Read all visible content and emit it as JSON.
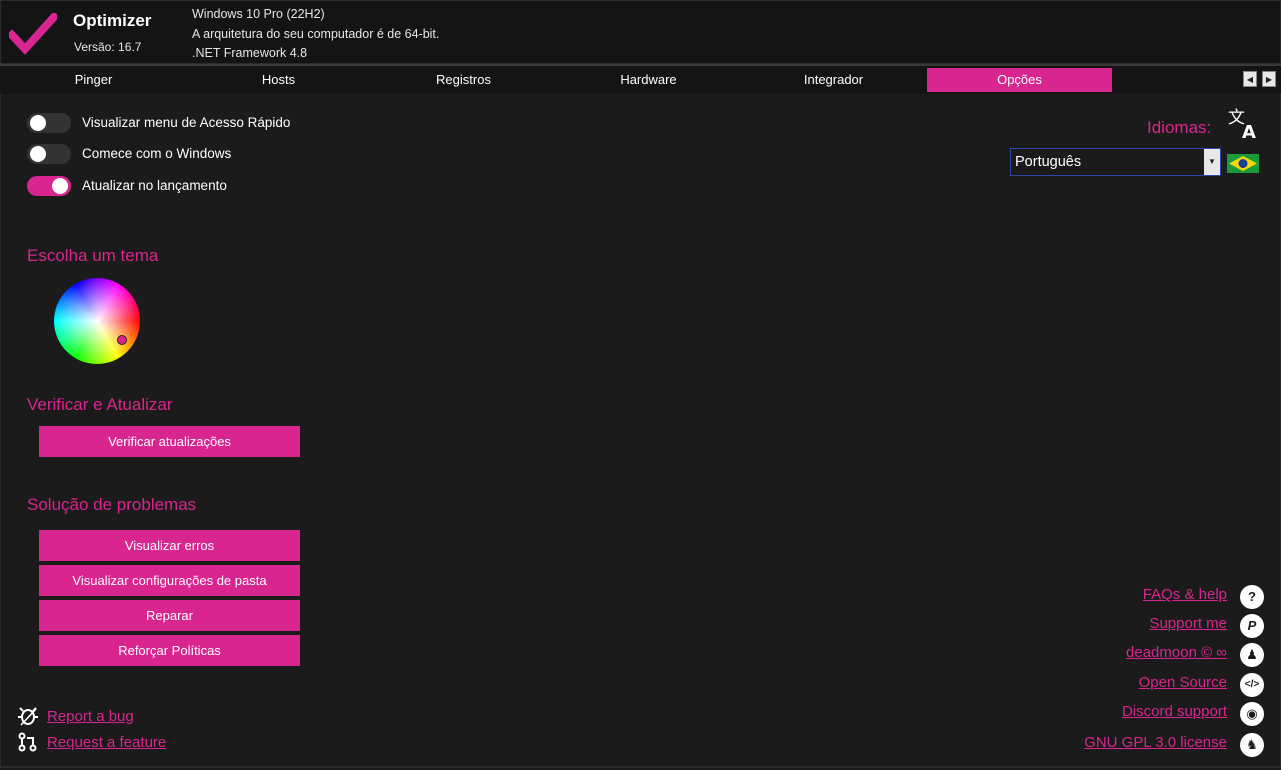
{
  "header": {
    "app_title": "Optimizer",
    "version": "Versão: 16.7",
    "os": "Windows 10 Pro (22H2)",
    "arch": "A arquitetura do seu computador é de 64-bit.",
    "framework": ".NET Framework 4.8",
    "logo_icon": "checkmark-icon"
  },
  "tabs": [
    {
      "label": "Pinger",
      "active": false
    },
    {
      "label": "Hosts",
      "active": false
    },
    {
      "label": "Registros",
      "active": false
    },
    {
      "label": "Hardware",
      "active": false
    },
    {
      "label": "Integrador",
      "active": false
    },
    {
      "label": "Opções",
      "active": true
    }
  ],
  "toggles": [
    {
      "label": "Visualizar menu de Acesso Rápido",
      "on": false
    },
    {
      "label": "Comece com o Windows",
      "on": false
    },
    {
      "label": "Atualizar no lançamento",
      "on": true
    }
  ],
  "theme": {
    "title": "Escolha um tema"
  },
  "update": {
    "title": "Verificar e Atualizar",
    "button": "Verificar atualizações"
  },
  "troubleshoot": {
    "title": "Solução de problemas",
    "buttons": [
      "Visualizar erros",
      "Visualizar configurações de pasta",
      "Reparar",
      "Reforçar Políticas"
    ]
  },
  "bottom_links": [
    {
      "label": "Report a bug",
      "icon": "bug-icon"
    },
    {
      "label": "Request a feature",
      "icon": "pull-request-icon"
    }
  ],
  "language": {
    "label": "Idiomas:",
    "selected": "Português",
    "flag": "brazil-flag-icon",
    "icon": "translate-icon"
  },
  "right_links": [
    {
      "label": "FAQs & help",
      "icon": "question-icon",
      "glyph": "?"
    },
    {
      "label": "Support me",
      "icon": "paypal-icon",
      "glyph": "P"
    },
    {
      "label": "deadmoon © ∞",
      "icon": "github-icon",
      "glyph": "♟"
    },
    {
      "label": "Open Source",
      "icon": "code-icon",
      "glyph": "</>"
    },
    {
      "label": "Discord support",
      "icon": "discord-icon",
      "glyph": "◉"
    },
    {
      "label": "GNU GPL 3.0 license",
      "icon": "gnu-icon",
      "glyph": "♞"
    }
  ],
  "colors": {
    "accent": "#d9258f",
    "background": "#1b1b1b",
    "header": "#141414"
  }
}
